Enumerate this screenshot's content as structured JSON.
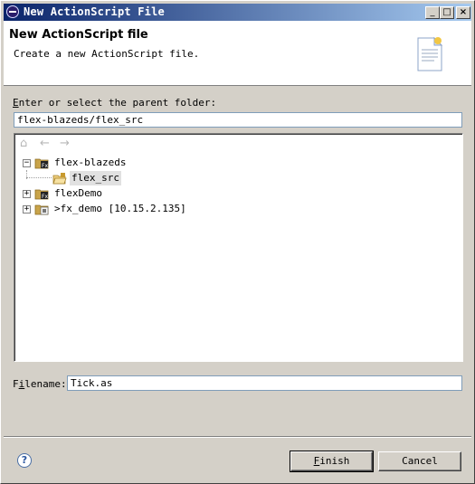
{
  "window": {
    "title": "New ActionScript File",
    "min_glyph": "_",
    "max_glyph": "□",
    "close_glyph": "×"
  },
  "header": {
    "title": "New ActionScript file",
    "subtitle": "Create a new ActionScript file."
  },
  "folder": {
    "label_accel": "E",
    "label_rest": "nter or select the parent folder:",
    "value": "flex-blazeds/flex_src"
  },
  "tree": {
    "nav": {
      "home": "⌂",
      "back": "←",
      "forward": "→"
    },
    "items": [
      {
        "label": "flex-blazeds",
        "expander": "−"
      },
      {
        "label": "flex_src"
      },
      {
        "label": "flexDemo",
        "expander": "+"
      },
      {
        "label": ">fx_demo    [10.15.2.135]",
        "expander": "+"
      }
    ]
  },
  "filename": {
    "label_accel": "i",
    "label_pre": "F",
    "label_post": "lename:",
    "value": "Tick.as"
  },
  "footer": {
    "help": "?",
    "finish_accel": "F",
    "finish_rest": "inish",
    "cancel": "Cancel"
  },
  "colors": {
    "titlebar_start": "#0a246a",
    "titlebar_end": "#a6caf0",
    "dialog_bg": "#d4d0c8"
  }
}
